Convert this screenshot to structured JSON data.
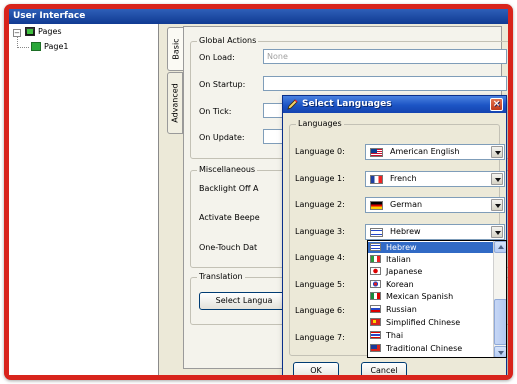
{
  "window": {
    "title": "User Interface"
  },
  "tree": {
    "root_toggle": "−",
    "root_label": "Pages",
    "child_label": "Page1"
  },
  "tabs": {
    "basic": "Basic",
    "advanced": "Advanced"
  },
  "global_actions": {
    "title": "Global Actions",
    "on_load_label": "On Load:",
    "on_load_value": "None",
    "on_startup_label": "On Startup:",
    "on_tick_label": "On Tick:",
    "on_update_label": "On Update:"
  },
  "miscellaneous": {
    "title": "Miscellaneous",
    "backlight_label": "Backlight Off A",
    "beeper_label": "Activate Beepe",
    "one_touch_label": "One-Touch Dat"
  },
  "translation": {
    "title": "Translation",
    "select_button": "Select Langua"
  },
  "dialog": {
    "title": "Select Languages",
    "close_glyph": "×",
    "group_title": "Languages",
    "labels": [
      "Language 0:",
      "Language 1:",
      "Language 2:",
      "Language 3:",
      "Language 4:",
      "Language 5:",
      "Language 6:",
      "Language 7:"
    ],
    "combos": [
      {
        "value": "American English",
        "flag": "us"
      },
      {
        "value": "French",
        "flag": "fr"
      },
      {
        "value": "German",
        "flag": "de"
      },
      {
        "value": "Hebrew",
        "flag": "il"
      }
    ],
    "dropdown_items": [
      {
        "label": "Hebrew",
        "flag": "il",
        "selected": true
      },
      {
        "label": "Italian",
        "flag": "it"
      },
      {
        "label": "Japanese",
        "flag": "jp"
      },
      {
        "label": "Korean",
        "flag": "kr"
      },
      {
        "label": "Mexican Spanish",
        "flag": "mx"
      },
      {
        "label": "Russian",
        "flag": "ru"
      },
      {
        "label": "Simplified Chinese",
        "flag": "cn"
      },
      {
        "label": "Thai",
        "flag": "th"
      },
      {
        "label": "Traditional Chinese",
        "flag": "tw"
      }
    ],
    "ok_label": "OK",
    "cancel_label": "Cancel"
  }
}
